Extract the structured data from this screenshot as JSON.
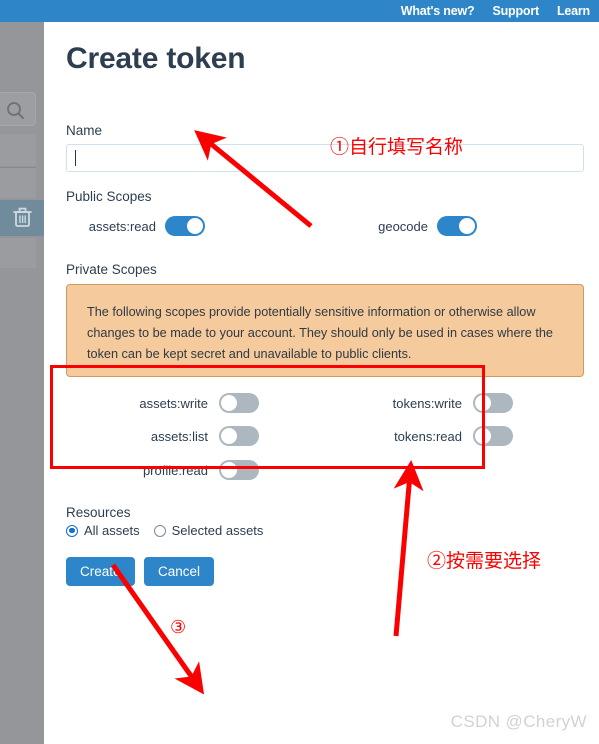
{
  "topbar": {
    "links": [
      {
        "label": "What's new?"
      },
      {
        "label": "Support"
      },
      {
        "label": "Learn"
      }
    ],
    "background_color": "#2e86c8"
  },
  "sidebar": {
    "background_color": "#949699",
    "icons": [
      {
        "name": "search-icon"
      },
      {
        "name": "trash-icon"
      }
    ]
  },
  "main": {
    "title": "Create token",
    "name_field": {
      "label": "Name",
      "value": "",
      "placeholder": ""
    },
    "public_scopes": {
      "label": "Public Scopes",
      "toggles": [
        {
          "label": "assets:read",
          "state": "on"
        },
        {
          "label": "geocode",
          "state": "on"
        }
      ]
    },
    "private_scopes": {
      "label": "Private Scopes",
      "notice": "The following scopes provide potentially sensitive information or otherwise allow changes to be made to your account. They should only be used in cases where the token can be kept secret and unavailable to public clients.",
      "notice_background": "#f5ca9d",
      "notice_border": "#ce9a63",
      "toggles_left": [
        {
          "label": "assets:write",
          "state": "off"
        },
        {
          "label": "assets:list",
          "state": "off"
        },
        {
          "label": "profile:read",
          "state": "off"
        }
      ],
      "toggles_right": [
        {
          "label": "tokens:write",
          "state": "off"
        },
        {
          "label": "tokens:read",
          "state": "off"
        }
      ]
    },
    "resources": {
      "label": "Resources",
      "options": [
        {
          "label": "All assets",
          "selected": true
        },
        {
          "label": "Selected assets",
          "selected": false
        }
      ]
    },
    "buttons": {
      "create": "Create",
      "cancel": "Cancel",
      "color": "#2d86c9"
    }
  },
  "annotations": {
    "color": "#fb0000",
    "note1": "①自行填写名称",
    "note2": "②按需要选择",
    "note3": "③"
  },
  "watermark": "CSDN @CheryW"
}
